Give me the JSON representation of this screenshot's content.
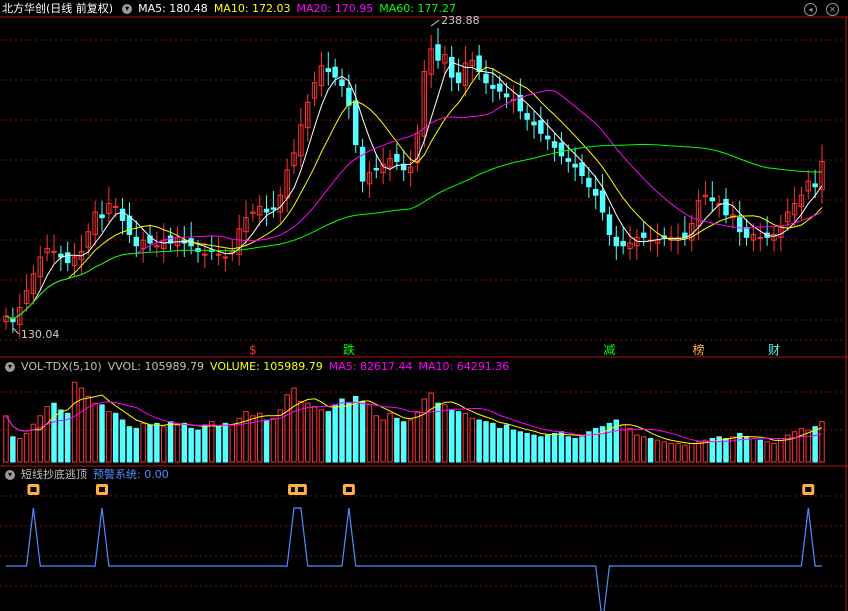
{
  "colors": {
    "up": "#ff3232",
    "down": "#54ffff",
    "ma5": "#ffffff",
    "ma10": "#ffff00",
    "ma20": "#ff00ff",
    "ma60": "#00ff00",
    "grid": "#7a1010",
    "signal": "#4d8eff",
    "text": "#c0c0c0",
    "label": "#cccccc"
  },
  "main": {
    "title": "北方华创(日线 前复权)",
    "ma_labels": [
      {
        "text": "MA5: 180.48",
        "color": "#ffffff"
      },
      {
        "text": "MA10: 172.03",
        "color": "#ffff00"
      },
      {
        "text": "MA20: 170.95",
        "color": "#ff00ff"
      },
      {
        "text": "MA60: 177.27",
        "color": "#00ff00"
      }
    ],
    "high_label": "238.88",
    "low_label": "130.04"
  },
  "events": [
    {
      "label": "$",
      "index": 36,
      "color": "#ff3232",
      "icon": "dollar-marker"
    },
    {
      "label": "跌",
      "index": 50,
      "color": "#00ff00"
    },
    {
      "label": "减",
      "index": 88,
      "color": "#00ff00"
    },
    {
      "label": "榜",
      "index": 101,
      "color": "#ffb040"
    },
    {
      "label": "财",
      "index": 112,
      "color": "#54ffff"
    }
  ],
  "vol": {
    "title": "VOL-TDX(5,10)",
    "labels": [
      {
        "text": "VVOL: 105989.79",
        "color": "#c0c0c0"
      },
      {
        "text": "VOLUME: 105989.79",
        "color": "#ffff00"
      },
      {
        "text": "MA5: 82617.44",
        "color": "#ff00ff"
      },
      {
        "text": "MA10: 64291.36",
        "color": "#ff00ff"
      }
    ]
  },
  "sig": {
    "title": "短线抄底逃顶",
    "label": "预警系统: 0.00",
    "marker_icon": "buy-marker-icon",
    "peaks_up": [
      4,
      14,
      42,
      43,
      50,
      117
    ],
    "peaks_down": [
      87
    ]
  },
  "chart_data": {
    "type": "candlestick",
    "n_candles": 120,
    "price_ylim": [
      130.04,
      238.88
    ],
    "high_index": 62,
    "low_index": 1,
    "ohlc_note": "daily candles, values estimated from image",
    "close": [
      135.0,
      133.0,
      138.0,
      144.0,
      150.0,
      156.0,
      159.0,
      158.0,
      156.0,
      154.0,
      156.0,
      158.0,
      165.0,
      172.0,
      170.0,
      175.0,
      174.0,
      169.0,
      164.0,
      160.0,
      162.0,
      161.0,
      160.0,
      162.0,
      161.0,
      163.0,
      161.0,
      160.0,
      158.0,
      157.0,
      158.0,
      157.0,
      156.0,
      158.0,
      166.0,
      170.0,
      172.0,
      174.0,
      172.0,
      173.0,
      178.0,
      187.0,
      193.0,
      203.0,
      211.0,
      218.0,
      224.0,
      222.0,
      220.0,
      217.0,
      210.0,
      196.0,
      183.0,
      186.0,
      187.0,
      189.0,
      191.0,
      190.0,
      187.0,
      188.0,
      200.0,
      222.0,
      230.0,
      226.0,
      228.0,
      220.0,
      218.0,
      225.0,
      226.0,
      222.0,
      218.0,
      216.0,
      215.0,
      213.0,
      212.0,
      208.0,
      205.0,
      203.0,
      200.0,
      198.0,
      195.0,
      192.0,
      190.0,
      188.0,
      185.0,
      181.0,
      178.0,
      172.0,
      164.0,
      160.0,
      160.0,
      161.0,
      163.0,
      163.0,
      162.0,
      162.0,
      163.0,
      163.0,
      163.0,
      163.0,
      168.0,
      176.0,
      178.0,
      176.0,
      175.0,
      171.0,
      171.0,
      165.0,
      163.0,
      164.0,
      163.0,
      163.0,
      164.0,
      167.0,
      172.0,
      175.0,
      178.0,
      183.0,
      181.0,
      190.0
    ],
    "volume": [
      55,
      30,
      28,
      34,
      45,
      55,
      66,
      70,
      62,
      58,
      95,
      88,
      78,
      70,
      68,
      60,
      58,
      50,
      42,
      40,
      46,
      44,
      46,
      42,
      48,
      44,
      46,
      40,
      38,
      44,
      48,
      42,
      46,
      44,
      52,
      60,
      55,
      58,
      50,
      52,
      62,
      80,
      88,
      72,
      70,
      66,
      62,
      60,
      68,
      75,
      70,
      78,
      72,
      68,
      55,
      50,
      58,
      52,
      48,
      50,
      60,
      75,
      82,
      70,
      68,
      62,
      60,
      58,
      52,
      50,
      48,
      46,
      40,
      44,
      38,
      36,
      34,
      32,
      30,
      32,
      34,
      36,
      30,
      28,
      30,
      36,
      40,
      42,
      46,
      50,
      44,
      40,
      32,
      30,
      28,
      26,
      24,
      22,
      22,
      20,
      22,
      24,
      26,
      28,
      30,
      28,
      30,
      34,
      30,
      28,
      26,
      24,
      22,
      28,
      32,
      36,
      40,
      38,
      42,
      48
    ]
  }
}
